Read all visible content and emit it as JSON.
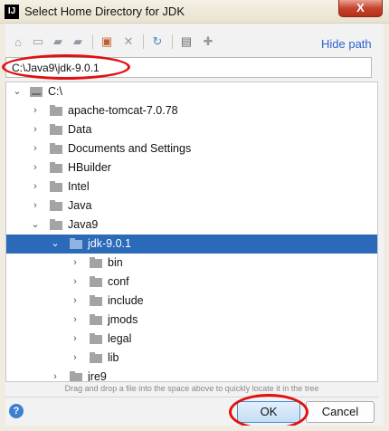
{
  "window": {
    "logo_text": "IJ",
    "title": "Select Home Directory for JDK",
    "close_glyph": "X"
  },
  "toolbar": {
    "icons": [
      "home-icon",
      "desktop-icon",
      "project-folder-icon",
      "module-folder-icon",
      "new-folder-icon",
      "delete-icon",
      "refresh-icon",
      "show-hidden-icon",
      "add-path-icon"
    ],
    "hide_path_label": "Hide path"
  },
  "path_field": {
    "value": "C:\\Java9\\jdk-9.0.1"
  },
  "tree": {
    "rows": [
      {
        "label": "C:\\",
        "expanded": true,
        "icon": "drive-icon"
      },
      {
        "label": "apache-tomcat-7.0.78",
        "expanded": false,
        "icon": "folder-icon"
      },
      {
        "label": "Data",
        "expanded": false,
        "icon": "folder-icon"
      },
      {
        "label": "Documents and Settings",
        "expanded": false,
        "icon": "folder-shortcut-icon"
      },
      {
        "label": "HBuilder",
        "expanded": false,
        "icon": "folder-icon"
      },
      {
        "label": "Intel",
        "expanded": false,
        "icon": "folder-icon"
      },
      {
        "label": "Java",
        "expanded": false,
        "icon": "folder-icon"
      },
      {
        "label": "Java9",
        "expanded": true,
        "icon": "folder-icon"
      },
      {
        "label": "jdk-9.0.1",
        "expanded": true,
        "icon": "folder-icon",
        "selected": true
      },
      {
        "label": "bin",
        "expanded": false,
        "icon": "folder-icon"
      },
      {
        "label": "conf",
        "expanded": false,
        "icon": "folder-icon"
      },
      {
        "label": "include",
        "expanded": false,
        "icon": "folder-icon"
      },
      {
        "label": "jmods",
        "expanded": false,
        "icon": "folder-icon"
      },
      {
        "label": "legal",
        "expanded": false,
        "icon": "folder-icon"
      },
      {
        "label": "lib",
        "expanded": false,
        "icon": "folder-icon"
      },
      {
        "label": "jre9",
        "expanded": false,
        "icon": "folder-icon"
      }
    ]
  },
  "hint": "Drag and drop a file into the space above to quickly locate it in the tree",
  "buttons": {
    "help": "?",
    "ok": "OK",
    "cancel": "Cancel"
  },
  "colors": {
    "selection": "#2a6ab8",
    "link": "#2f65ca",
    "annotation_red": "#e01010"
  }
}
